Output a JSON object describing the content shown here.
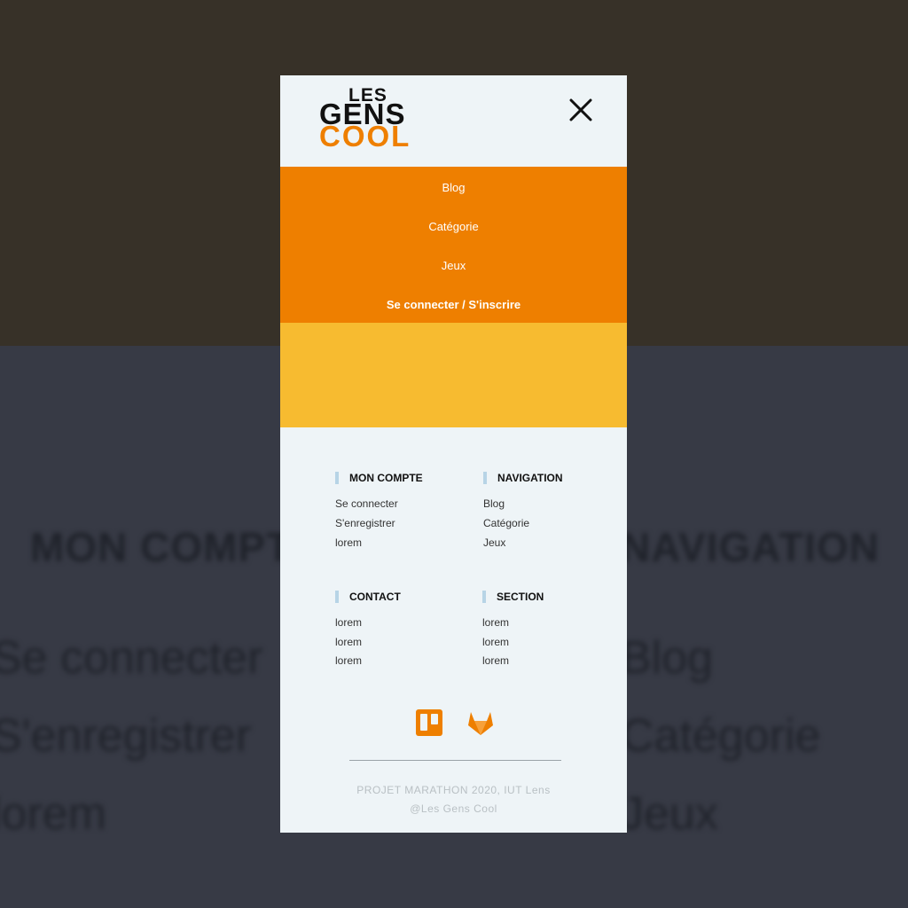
{
  "background": {
    "headings": [
      "MON COMPTE",
      "NAVIGATION"
    ],
    "links": [
      "Se connecter",
      "S'enregistrer",
      "lorem",
      "Blog",
      "Catégorie",
      "Jeux"
    ]
  },
  "logo": {
    "line1": "LES",
    "line2": "GENS",
    "line3": "COOL"
  },
  "close_icon": "close-icon",
  "menu": {
    "items": [
      "Blog",
      "Catégorie",
      "Jeux",
      "Se connecter / S'inscrire"
    ]
  },
  "footer": {
    "mon_compte": {
      "title": "MON COMPTE",
      "links": [
        "Se connecter",
        "S'enregistrer",
        "lorem"
      ]
    },
    "navigation": {
      "title": "NAVIGATION",
      "links": [
        "Blog",
        "Catégorie",
        "Jeux"
      ]
    },
    "contact": {
      "title": "CONTACT",
      "links": [
        "lorem",
        "lorem",
        "lorem"
      ]
    },
    "section": {
      "title": "SECTION",
      "links": [
        "lorem",
        "lorem",
        "lorem"
      ]
    },
    "social": [
      "trello-icon",
      "gitlab-icon"
    ],
    "copyright_line1": "PROJET MARATHON 2020, IUT Lens",
    "copyright_line2": "@Les Gens Cool"
  },
  "colors": {
    "accent_orange": "#ee7f00",
    "accent_yellow": "#f7bb30",
    "panel_bg": "#eef4f7"
  }
}
